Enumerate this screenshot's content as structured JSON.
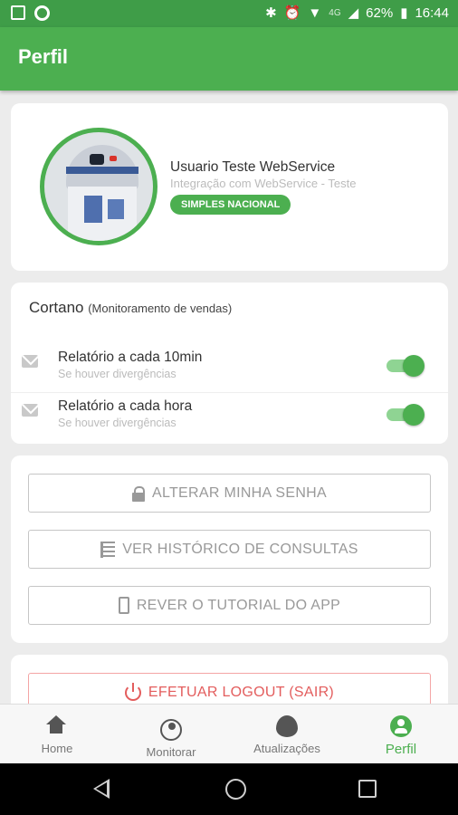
{
  "status_bar": {
    "battery": "62%",
    "time": "16:44",
    "network": "4G",
    "icons": [
      "image-icon",
      "circle-icon",
      "bluetooth-icon",
      "alarm-icon",
      "wifi-icon",
      "signal-icon",
      "battery-icon"
    ]
  },
  "app_bar": {
    "title": "Perfil"
  },
  "profile": {
    "name": "Usuario Teste WebService",
    "subtitle": "Integração com WebService - Teste",
    "badge": "SIMPLES NACIONAL"
  },
  "monitoring": {
    "title": "Cortano",
    "subtitle": "(Monitoramento de vendas)",
    "items": [
      {
        "label": "Relatório a cada 10min",
        "sub": "Se houver divergências",
        "enabled": true
      },
      {
        "label": "Relatório a cada hora",
        "sub": "Se houver divergências",
        "enabled": true
      }
    ]
  },
  "actions": {
    "change_password": "ALTERAR MINHA SENHA",
    "history": "VER HISTÓRICO DE CONSULTAS",
    "tutorial": "REVER O TUTORIAL DO APP",
    "logout": "EFETUAR LOGOUT (SAIR)"
  },
  "bottom_nav": {
    "items": [
      {
        "label": "Home",
        "icon": "home-icon"
      },
      {
        "label": "Monitorar",
        "icon": "eye-icon"
      },
      {
        "label": "Atualizações",
        "icon": "flame-icon"
      },
      {
        "label": "Perfil",
        "icon": "user-icon",
        "active": true
      }
    ]
  },
  "colors": {
    "primary": "#4caf50",
    "primary_dark": "#3f9d48",
    "danger": "#e35d5d"
  }
}
